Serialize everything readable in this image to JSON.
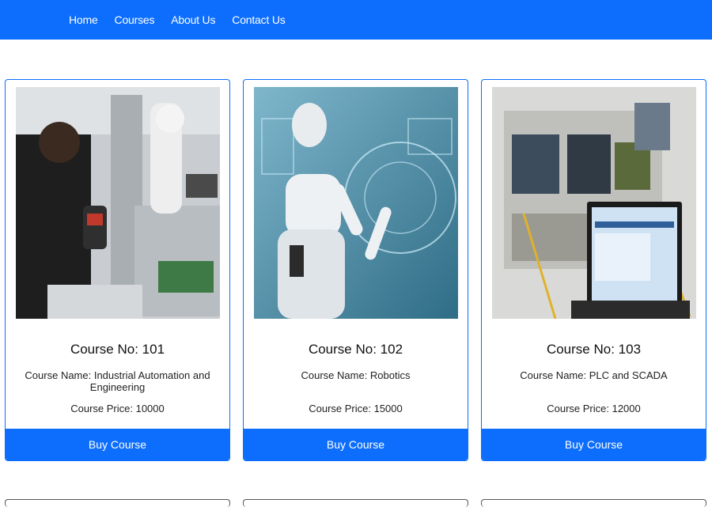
{
  "nav": {
    "items": [
      "Home",
      "Courses",
      "About Us",
      "Contact Us"
    ]
  },
  "courses": [
    {
      "number": "Course No: 101",
      "name": "Course Name: Industrial Automation and Engineering",
      "price": "Course Price: 10000",
      "button": "Buy Course",
      "image": "industrial-automation-photo"
    },
    {
      "number": "Course No: 102",
      "name": "Course Name: Robotics",
      "price": "Course Price: 15000",
      "button": "Buy Course",
      "image": "robot-photo"
    },
    {
      "number": "Course No: 103",
      "name": "Course Name: PLC and SCADA",
      "price": "Course Price: 12000",
      "button": "Buy Course",
      "image": "plc-panel-photo"
    }
  ],
  "colors": {
    "primary": "#0d6efd",
    "text": "#111111"
  }
}
